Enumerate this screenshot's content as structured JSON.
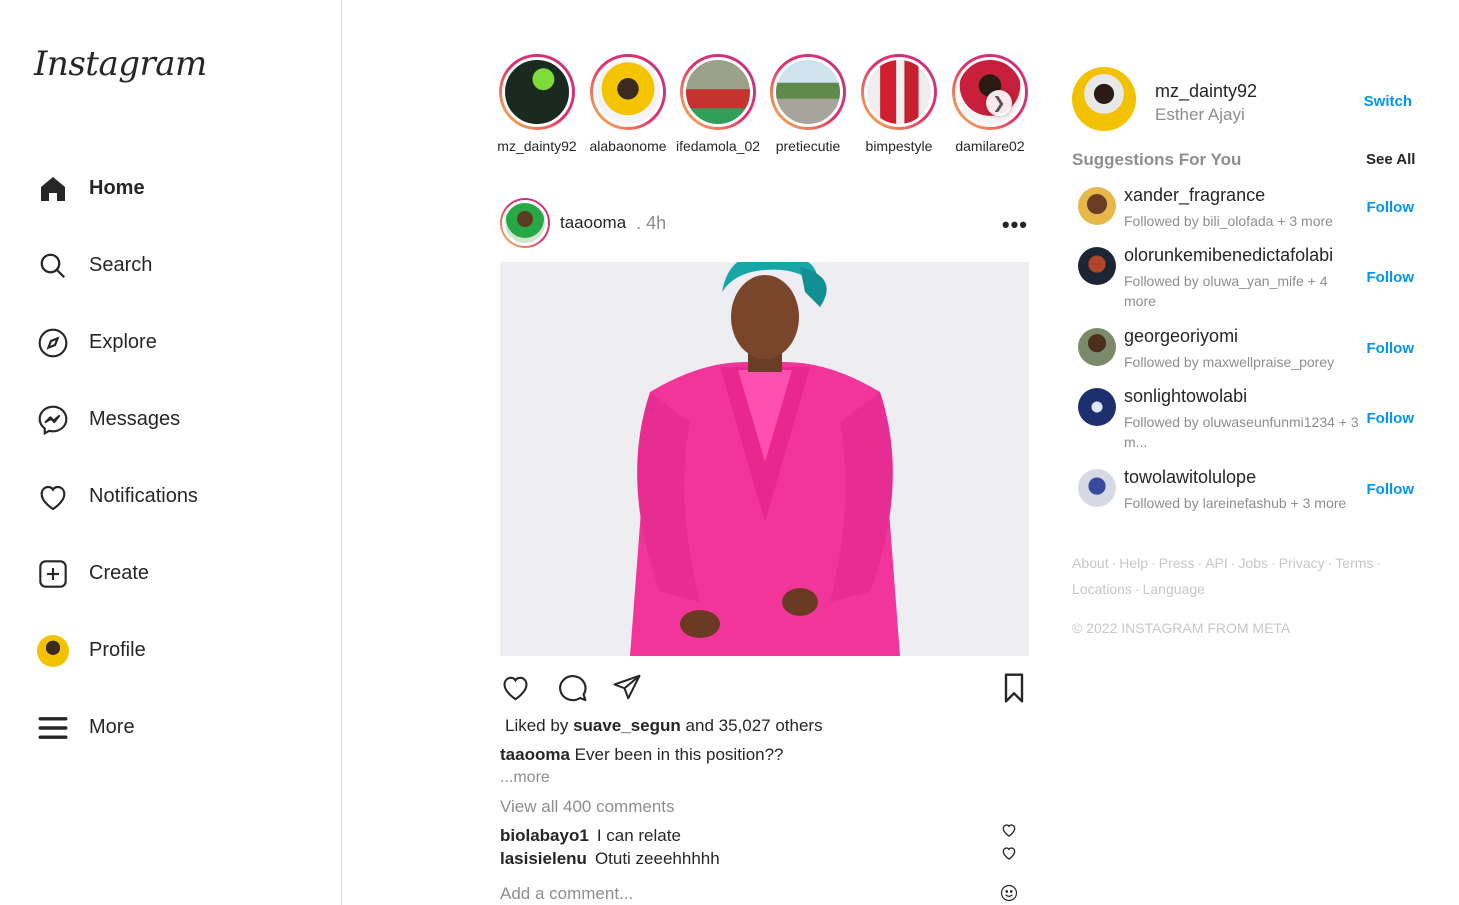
{
  "brand": {
    "logo_text": "Instagram"
  },
  "sidebar": {
    "items": [
      {
        "label": "Home",
        "icon": "home-icon"
      },
      {
        "label": "Search",
        "icon": "search-icon"
      },
      {
        "label": "Explore",
        "icon": "compass-icon"
      },
      {
        "label": "Messages",
        "icon": "messenger-icon"
      },
      {
        "label": "Notifications",
        "icon": "heart-icon"
      },
      {
        "label": "Create",
        "icon": "plus-square-icon"
      },
      {
        "label": "Profile",
        "icon": "avatar"
      },
      {
        "label": "More",
        "icon": "hamburger-icon"
      }
    ]
  },
  "stories": [
    {
      "name": "mz_dainty92"
    },
    {
      "name": "alabaonome"
    },
    {
      "name": "ifedamola_02"
    },
    {
      "name": "pretiecutie"
    },
    {
      "name": "bimpestyle"
    },
    {
      "name": "damilare02"
    }
  ],
  "post": {
    "username": "taaooma",
    "time": ". 4h",
    "likes_prefix": "Liked by",
    "liked_by": "suave_segun",
    "likes_suffix": "and 35,027 others",
    "caption_user": "taaooma",
    "caption_text": "Ever been in this position??",
    "more_label": "...more",
    "view_all": "View all 400 comments",
    "comments": [
      {
        "user": "biolabayo1",
        "text": "I can relate"
      },
      {
        "user": "lasisielenu",
        "text": "Otuti zeeehhhhh"
      }
    ],
    "add_comment_placeholder": "Add a comment..."
  },
  "me": {
    "username": "mz_dainty92",
    "full_name": "Esther Ajayi",
    "switch_label": "Switch"
  },
  "suggestions": {
    "title": "Suggestions For You",
    "see_all": "See All",
    "follow_label": "Follow",
    "items": [
      {
        "username": "xander_fragrance",
        "followed_by": "Followed by bili_olofada + 3 more"
      },
      {
        "username": "olorunkemibenedictafolabi",
        "followed_by": "Followed by oluwa_yan_mife + 4 more"
      },
      {
        "username": "georgeoriyomi",
        "followed_by": "Followed by maxwellpraise_porey"
      },
      {
        "username": "sonlightowolabi",
        "followed_by": "Followed by oluwaseunfunmi1234 + 3 m..."
      },
      {
        "username": "towolawitolulope",
        "followed_by": "Followed by lareinefashub + 3 more"
      }
    ]
  },
  "footer": {
    "links": [
      "About",
      "Help",
      "Press",
      "API",
      "Jobs",
      "Privacy",
      "Terms",
      "Locations",
      "Language"
    ],
    "copyright": "© 2022 INSTAGRAM FROM META"
  },
  "colors": {
    "link_blue": "#0095f6",
    "muted": "#8e8e8e",
    "story_ring": "#e1306c",
    "suit_pink": "#f2359b",
    "gele_teal": "#17a6a8"
  }
}
